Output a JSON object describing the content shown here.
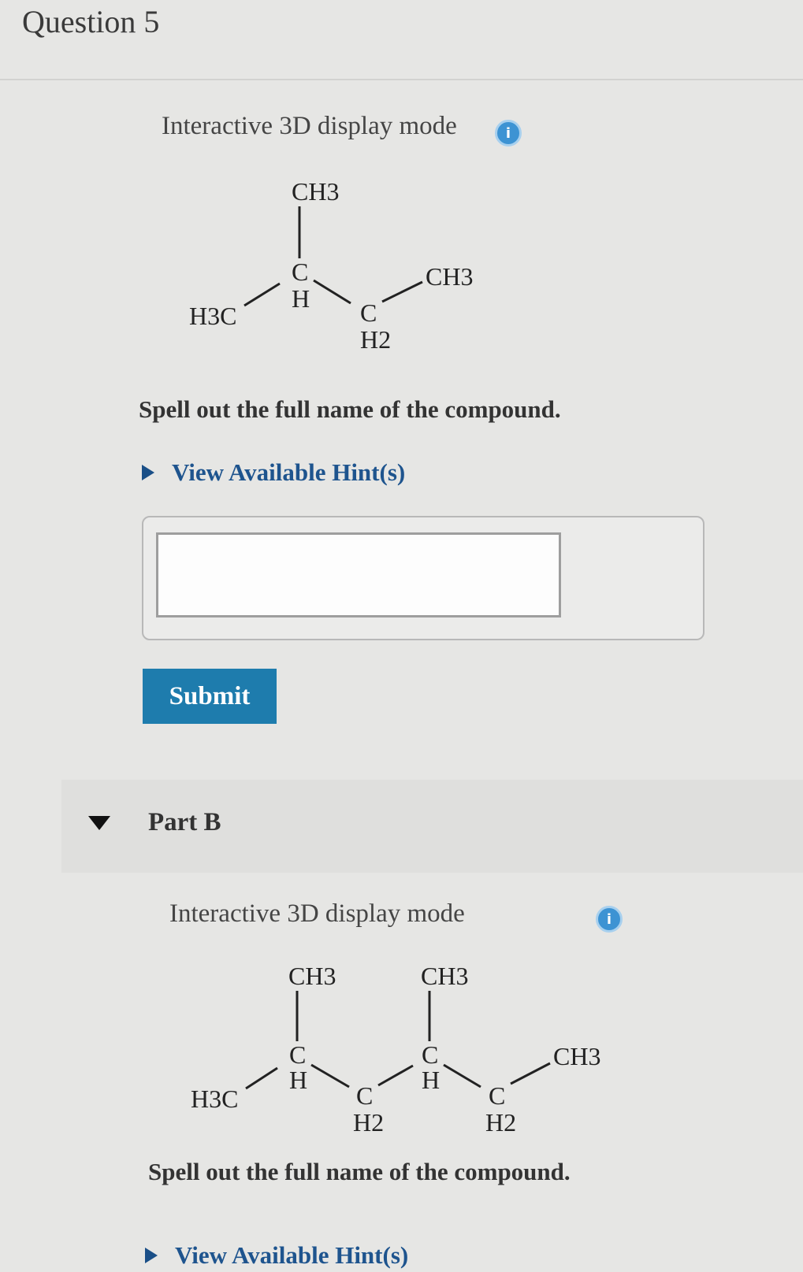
{
  "question": {
    "title": "Question 5"
  },
  "part_a": {
    "display_mode_label": "Interactive 3D display mode",
    "info_icon": "info-icon",
    "structure": {
      "ch3_top": "CH3",
      "c": "C",
      "h": "H",
      "h3c": "H3C",
      "c2": "C",
      "h2": "H2",
      "ch3_right": "CH3"
    },
    "prompt": "Spell out the full name of the compound.",
    "hint_link": "View Available Hint(s)",
    "answer": {
      "value": "",
      "placeholder": ""
    },
    "submit_label": "Submit"
  },
  "part_b": {
    "label": "Part B",
    "display_mode_label": "Interactive 3D display mode",
    "info_icon": "info-icon",
    "structure": {
      "ch3_top_1": "CH3",
      "ch3_top_2": "CH3",
      "c1": "C",
      "h1": "H",
      "c3": "C",
      "h3": "H",
      "h3c": "H3C",
      "c2": "C",
      "h2_1": "H2",
      "c4": "C",
      "h2_2": "H2",
      "ch3_right": "CH3"
    },
    "prompt": "Spell out the full name of the compound.",
    "hint_link": "View Available Hint(s)"
  }
}
